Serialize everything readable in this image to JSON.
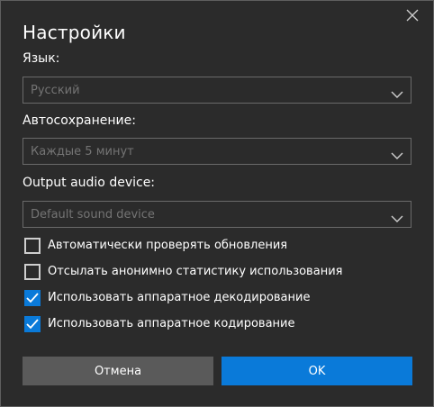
{
  "dialog": {
    "title": "Настройки",
    "close_icon": "close-icon"
  },
  "language": {
    "label": "Язык:",
    "value": "Русский"
  },
  "autosave": {
    "label": "Автосохранение:",
    "value": "Каждые 5 минут"
  },
  "audio": {
    "label": "Output audio device:",
    "value": "Default sound device"
  },
  "options": [
    {
      "label": "Автоматически проверять обновления",
      "checked": false
    },
    {
      "label": "Отсылать анонимно статистику использования",
      "checked": false
    },
    {
      "label": "Использовать аппаратное декодирование",
      "checked": true
    },
    {
      "label": "Использовать аппаратное кодирование",
      "checked": true
    }
  ],
  "buttons": {
    "cancel_label": "Отмена",
    "ok_label": "OK"
  },
  "colors": {
    "background": "#2b2b2b",
    "accent": "#0a7ad9",
    "cancel_button": "#5a5a5a",
    "muted_text": "#747474"
  }
}
